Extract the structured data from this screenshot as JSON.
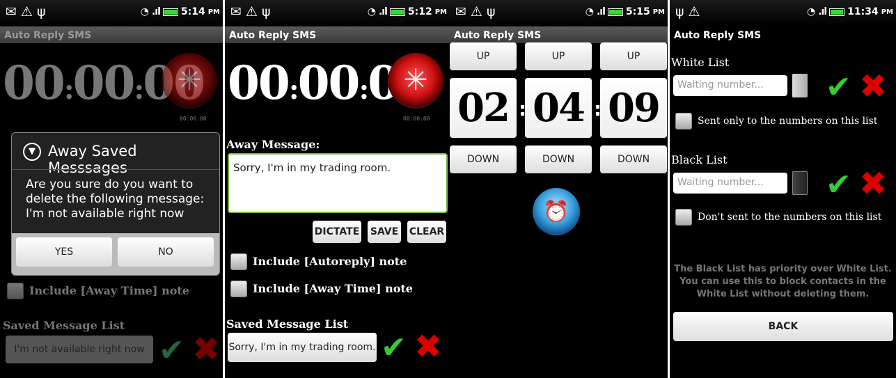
{
  "app_title": "Auto Reply SMS",
  "screens": [
    {
      "status": {
        "time": "5:14",
        "ampm": "PM"
      },
      "timer": {
        "h": "00",
        "m": "00",
        "s": "00",
        "rec_time": "00:00:00"
      },
      "dialog": {
        "title": "Away Saved Messsages",
        "body": "Are you sure do you want to delete the following message: I'm not available right now",
        "yes": "YES",
        "no": "NO"
      },
      "include_away_time": "Include [Away Time] note",
      "saved_list_label": "Saved Message List",
      "saved_item": "I'm not available right now"
    },
    {
      "status": {
        "time": "5:12",
        "ampm": "PM"
      },
      "timer": {
        "h": "00",
        "m": "00",
        "s": "00",
        "rec_time": "00:00:00"
      },
      "away_label": "Away Message:",
      "message_value": "Sorry, I'm in my trading room.",
      "buttons": {
        "dictate": "DICTATE",
        "save": "SAVE",
        "clear": "CLEAR"
      },
      "include_autoreply": "Include [Autoreply] note",
      "include_away_time": "Include [Away Time] note",
      "saved_list_label": "Saved Message List",
      "saved_item": "Sorry, I'm in my trading room."
    },
    {
      "status": {
        "time": "5:15",
        "ampm": "PM"
      },
      "up": "UP",
      "down": "DOWN",
      "digits": [
        "02",
        "04",
        "09"
      ]
    },
    {
      "status": {
        "time": "11:34",
        "ampm": "PM"
      },
      "white_list_label": "White List",
      "white_placeholder": "Waiting number...",
      "white_check_label": "Sent only to the numbers on this list",
      "black_list_label": "Black List",
      "black_placeholder": "Waiting number...",
      "black_check_label": "Don't sent to the numbers on this list",
      "note": "The Black List has priority over White List. You can use this to block contacts in the White List without deleting them.",
      "back": "BACK"
    }
  ],
  "colors": {
    "accent_green": "#3cc33c",
    "delete_red": "#dd0000",
    "input_border": "#7ab648"
  }
}
